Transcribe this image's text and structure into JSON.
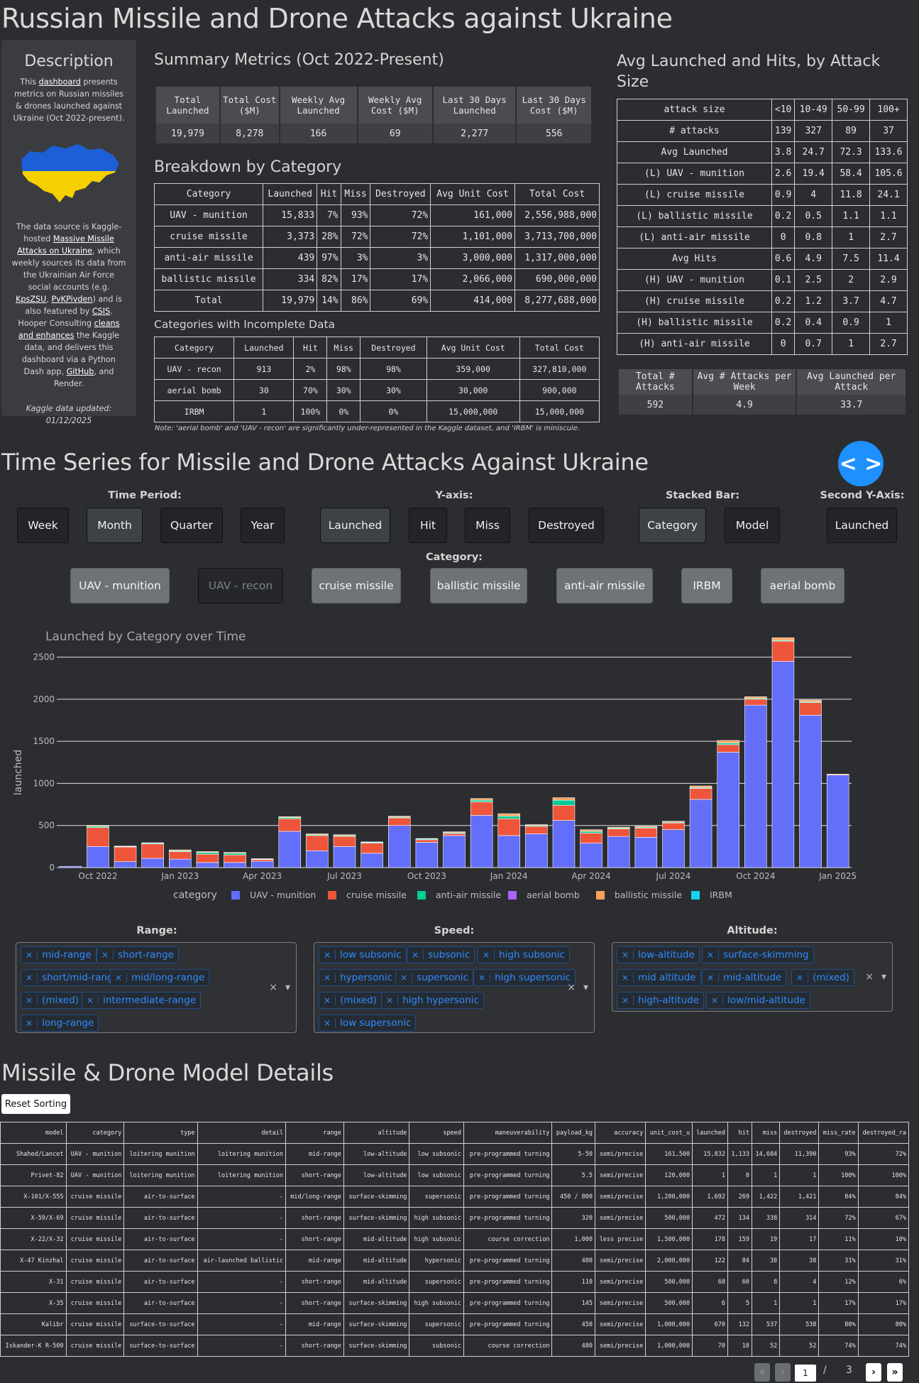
{
  "page_title": "Russian Missile and Drone Attacks against Ukraine",
  "description": {
    "heading": "Description",
    "p1_a": "This ",
    "p1_link": "dashboard",
    "p1_b": " presents metrics on Russian missiles & drones launched against Ukraine (Oct 2022-present).",
    "p2_a": "The data source is Kaggle-hosted ",
    "p2_link1": "Massive Missile Attacks on Ukraine",
    "p2_b": ", which weekly sources its data from the Ukrainian Air Force social accounts (e.g. ",
    "p2_link2": "KpsZSU",
    "p2_c": ", ",
    "p2_link3": "PvKPivden",
    "p2_d": ") and is also featured by ",
    "p2_link4": "CSIS",
    "p2_e": ". Hooper Consulting ",
    "p2_link5": "cleans and enhances",
    "p2_f": " the Kaggle data, and delivers this dashboard via a Python Dash app, ",
    "p2_link6": "GitHub",
    "p2_g": ", and Render.",
    "updated": "Kaggle data updated: 01/12/2025"
  },
  "summary": {
    "heading": "Summary Metrics (Oct 2022-Present)",
    "headers": [
      "Total Launched",
      "Total Cost ($M)",
      "Weekly Avg Launched",
      "Weekly Avg Cost ($M)",
      "Last 30 Days Launched",
      "Last 30 Days Cost ($M)"
    ],
    "values": [
      "19,979",
      "8,278",
      "166",
      "69",
      "2,277",
      "556"
    ]
  },
  "breakdown": {
    "heading": "Breakdown by Category",
    "headers": [
      "Category",
      "Launched",
      "Hit",
      "Miss",
      "Destroyed",
      "Avg Unit Cost",
      "Total Cost"
    ],
    "rows": [
      [
        "UAV - munition",
        "15,833",
        "7%",
        "93%",
        "72%",
        "161,000",
        "2,556,988,000"
      ],
      [
        "cruise missile",
        "3,373",
        "28%",
        "72%",
        "72%",
        "1,101,000",
        "3,713,700,000"
      ],
      [
        "anti-air missile",
        "439",
        "97%",
        "3%",
        "3%",
        "3,000,000",
        "1,317,000,000"
      ],
      [
        "ballistic missile",
        "334",
        "82%",
        "17%",
        "17%",
        "2,066,000",
        "690,000,000"
      ],
      [
        "Total",
        "19,979",
        "14%",
        "86%",
        "69%",
        "414,000",
        "8,277,688,000"
      ]
    ]
  },
  "incomplete": {
    "heading": "Categories with Incomplete Data",
    "headers": [
      "Category",
      "Launched",
      "Hit",
      "Miss",
      "Destroyed",
      "Avg Unit Cost",
      "Total Cost"
    ],
    "rows": [
      [
        "UAV - recon",
        "913",
        "2%",
        "98%",
        "98%",
        "359,000",
        "327,810,000"
      ],
      [
        "aerial bomb",
        "30",
        "70%",
        "30%",
        "30%",
        "30,000",
        "900,000"
      ],
      [
        "IRBM",
        "1",
        "100%",
        "0%",
        "0%",
        "15,000,000",
        "15,000,000"
      ]
    ],
    "note": "Note: 'aerial bomb' and 'UAV - recon' are significantly under-represented in the Kaggle dataset, and 'IRBM' is miniscule."
  },
  "attack_size": {
    "heading": "Avg Launched and Hits, by Attack Size",
    "headers": [
      "attack size",
      "<10",
      "10-49",
      "50-99",
      "100+"
    ],
    "rows": [
      [
        "# attacks",
        "139",
        "327",
        "89",
        "37"
      ],
      [
        "Avg Launched",
        "3.8",
        "24.7",
        "72.3",
        "133.6"
      ],
      [
        "(L) UAV - munition",
        "2.6",
        "19.4",
        "58.4",
        "105.6"
      ],
      [
        "(L) cruise missile",
        "0.9",
        "4",
        "11.8",
        "24.1"
      ],
      [
        "(L) ballistic missile",
        "0.2",
        "0.5",
        "1.1",
        "1.1"
      ],
      [
        "(L) anti-air missile",
        "0",
        "0.8",
        "1",
        "2.7"
      ],
      [
        "Avg Hits",
        "0.6",
        "4.9",
        "7.5",
        "11.4"
      ],
      [
        "(H) UAV - munition",
        "0.1",
        "2.5",
        "2",
        "2.9"
      ],
      [
        "(H) cruise missile",
        "0.2",
        "1.2",
        "3.7",
        "4.7"
      ],
      [
        "(H) ballistic missile",
        "0.2",
        "0.4",
        "0.9",
        "1"
      ],
      [
        "(H) anti-air missile",
        "0",
        "0.7",
        "1",
        "2.7"
      ]
    ],
    "totals_headers": [
      "Total # Attacks",
      "Avg # Attacks per Week",
      "Avg Launched per Attack"
    ],
    "totals_values": [
      "592",
      "4.9",
      "33.7"
    ]
  },
  "timeseries": {
    "heading": "Time Series for Missile and Drone Attacks Against Ukraine",
    "toggle_icon": "< >",
    "time_period_label": "Time Period:",
    "time_period_options": [
      "Week",
      "Month",
      "Quarter",
      "Year"
    ],
    "yaxis_label": "Y-axis:",
    "yaxis_options": [
      "Launched",
      "Hit",
      "Miss",
      "Destroyed"
    ],
    "stacked_label": "Stacked Bar:",
    "stacked_options": [
      "Category",
      "Model"
    ],
    "second_label": "Second Y-Axis:",
    "second_option": "Launched",
    "category_label": "Category:",
    "category_options": [
      "UAV - munition",
      "UAV - recon",
      "cruise missile",
      "ballistic missile",
      "anti-air missile",
      "IRBM",
      "aerial bomb"
    ]
  },
  "chart_data": {
    "type": "bar",
    "title": "Launched by Category over Time",
    "xlabel": "",
    "ylabel": "launched",
    "ylim": [
      0,
      2800
    ],
    "yticks": [
      0,
      500,
      1000,
      1500,
      2000,
      2500
    ],
    "xticks": [
      "Oct 2022",
      "Jan 2023",
      "Apr 2023",
      "Jul 2023",
      "Oct 2023",
      "Jan 2024",
      "Apr 2024",
      "Jul 2024",
      "Oct 2024",
      "Jan 2025"
    ],
    "xtick_index": [
      1,
      4,
      7,
      10,
      13,
      16,
      19,
      22,
      25,
      28
    ],
    "legend_title": "category",
    "legend_position": "bottom",
    "grid": true,
    "categories": [
      "Sep 2022",
      "Oct 2022",
      "Nov 2022",
      "Dec 2022",
      "Jan 2023",
      "Feb 2023",
      "Mar 2023",
      "Apr 2023",
      "May 2023",
      "Jun 2023",
      "Jul 2023",
      "Aug 2023",
      "Sep 2023",
      "Oct 2023",
      "Nov 2023",
      "Dec 2023",
      "Jan 2024",
      "Feb 2024",
      "Mar 2024",
      "Apr 2024",
      "May 2024",
      "Jun 2024",
      "Jul 2024",
      "Aug 2024",
      "Sep 2024",
      "Oct 2024",
      "Nov 2024",
      "Dec 2024",
      "Jan 2025"
    ],
    "series": [
      {
        "name": "UAV - munition",
        "color": "#636efa",
        "values": [
          15,
          250,
          70,
          110,
          100,
          60,
          60,
          75,
          430,
          200,
          250,
          170,
          500,
          300,
          380,
          620,
          380,
          400,
          560,
          290,
          370,
          360,
          450,
          810,
          1370,
          1930,
          2450,
          1810,
          1100
        ]
      },
      {
        "name": "cruise missile",
        "color": "#ef553b",
        "values": [
          0,
          225,
          175,
          170,
          90,
          100,
          90,
          20,
          150,
          180,
          120,
          120,
          90,
          30,
          25,
          160,
          200,
          90,
          180,
          120,
          90,
          110,
          80,
          130,
          90,
          70,
          240,
          150,
          0
        ]
      },
      {
        "name": "anti-air missile",
        "color": "#00cc96",
        "values": [
          0,
          15,
          5,
          10,
          10,
          20,
          20,
          5,
          15,
          10,
          10,
          10,
          10,
          10,
          10,
          20,
          30,
          10,
          60,
          20,
          10,
          10,
          10,
          10,
          20,
          10,
          10,
          10,
          0
        ]
      },
      {
        "name": "aerial bomb",
        "color": "#ab63fa",
        "values": [
          0,
          0,
          0,
          0,
          0,
          0,
          0,
          0,
          0,
          0,
          0,
          0,
          0,
          0,
          0,
          0,
          0,
          0,
          0,
          0,
          0,
          0,
          0,
          0,
          0,
          0,
          0,
          0,
          0
        ]
      },
      {
        "name": "ballistic missile",
        "color": "#ffa15a",
        "values": [
          0,
          10,
          5,
          5,
          10,
          10,
          10,
          5,
          10,
          10,
          10,
          5,
          10,
          5,
          10,
          20,
          30,
          10,
          30,
          20,
          10,
          10,
          10,
          20,
          30,
          20,
          30,
          20,
          10
        ]
      },
      {
        "name": "IRBM",
        "color": "#19d3f3",
        "values": [
          0,
          0,
          0,
          0,
          0,
          0,
          0,
          0,
          0,
          0,
          0,
          0,
          0,
          0,
          0,
          0,
          0,
          0,
          0,
          0,
          0,
          0,
          0,
          0,
          0,
          0,
          0,
          0,
          0
        ]
      }
    ]
  },
  "filters": {
    "range_label": "Range:",
    "range_tags": [
      "mid-range",
      "short-range",
      "short/mid-range",
      "mid/long-range",
      "(mixed)",
      "intermediate-range",
      "long-range"
    ],
    "speed_label": "Speed:",
    "speed_tags": [
      "low subsonic",
      "subsonic",
      "high subsonic",
      "hypersonic",
      "supersonic",
      "high supersonic",
      "(mixed)",
      "high hypersonic",
      "low supersonic"
    ],
    "altitude_label": "Altitude:",
    "altitude_tags": [
      "low-altitude",
      "surface-skimming",
      "mid altitude",
      "mid-altitude",
      "(mixed)",
      "high-altitude",
      "low/mid-altitude"
    ],
    "clear_icon": "×",
    "dropdown_icon": "▾"
  },
  "details": {
    "heading": "Missile & Drone Model Details",
    "reset_label": "Reset Sorting",
    "headers": [
      "model",
      "category",
      "type",
      "detail",
      "range",
      "altitude",
      "speed",
      "maneuverability",
      "payload_kg",
      "accuracy",
      "unit_cost_u",
      "launched",
      "hit",
      "miss",
      "destroyed",
      "miss_rate",
      "destroyed_ra"
    ],
    "rows": [
      [
        "Shahed/Lancet",
        "UAV - munition",
        "loitering munition",
        "loitering munition",
        "mid-range",
        "low-altitude",
        "low subsonic",
        "pre-programmed turning",
        "5-50",
        "semi/precise",
        "161,500",
        "15,832",
        "1,133",
        "14,684",
        "11,390",
        "93%",
        "72%"
      ],
      [
        "Privet-82",
        "UAV - munition",
        "loitering munition",
        "loitering munition",
        "short-range",
        "low-altitude",
        "low subsonic",
        "pre-programmed turning",
        "5.5",
        "semi/precise",
        "120,000",
        "1",
        "0",
        "1",
        "1",
        "100%",
        "100%"
      ],
      [
        "X-101/X-555",
        "cruise missile",
        "air-to-surface",
        "-",
        "mid/long-range",
        "surface-skimming",
        "supersonic",
        "pre-programmed turning",
        "450 / 800",
        "semi/precise",
        "1,200,000",
        "1,692",
        "269",
        "1,422",
        "1,421",
        "84%",
        "84%"
      ],
      [
        "X-59/X-69",
        "cruise missile",
        "air-to-surface",
        "-",
        "short-range",
        "surface-skimming",
        "high subsonic",
        "pre-programmed turning",
        "320",
        "semi/precise",
        "500,000",
        "472",
        "134",
        "338",
        "314",
        "72%",
        "67%"
      ],
      [
        "X-22/X-32",
        "cruise missile",
        "air-to-surface",
        "-",
        "short-range",
        "mid-altitude",
        "high subsonic",
        "course correction",
        "1,000",
        "less precise",
        "1,500,000",
        "178",
        "159",
        "19",
        "17",
        "11%",
        "10%"
      ],
      [
        "X-47 Kinzhal",
        "cruise missile",
        "air-to-surface",
        "air-launched ballistic",
        "mid-range",
        "mid-altitude",
        "hypersonic",
        "pre-programmed turning",
        "480",
        "semi/precise",
        "2,000,000",
        "122",
        "84",
        "38",
        "38",
        "31%",
        "31%"
      ],
      [
        "X-31",
        "cruise missile",
        "air-to-surface",
        "-",
        "short-range",
        "mid-altitude",
        "supersonic",
        "pre-programmed turning",
        "110",
        "semi/precise",
        "500,000",
        "68",
        "60",
        "8",
        "4",
        "12%",
        "6%"
      ],
      [
        "X-35",
        "cruise missile",
        "air-to-surface",
        "-",
        "short-range",
        "surface-skimming",
        "high subsonic",
        "pre-programmed turning",
        "145",
        "semi/precise",
        "500,000",
        "6",
        "5",
        "1",
        "1",
        "17%",
        "17%"
      ],
      [
        "Kalibr",
        "cruise missile",
        "surface-to-surface",
        "-",
        "mid-range",
        "surface-skimming",
        "supersonic",
        "pre-programmed turning",
        "450",
        "semi/precise",
        "1,000,000",
        "670",
        "132",
        "537",
        "538",
        "80%",
        "80%"
      ],
      [
        "Iskander-K R-500",
        "cruise missile",
        "surface-to-surface",
        "-",
        "short-range",
        "surface-skimming",
        "subsonic",
        "course correction",
        "480",
        "semi/precise",
        "1,000,000",
        "70",
        "18",
        "52",
        "52",
        "74%",
        "74%"
      ]
    ],
    "pager": {
      "first": "«",
      "prev": "‹",
      "page": "1",
      "sep": "/",
      "total": "3",
      "next": "›",
      "last": "»"
    }
  }
}
